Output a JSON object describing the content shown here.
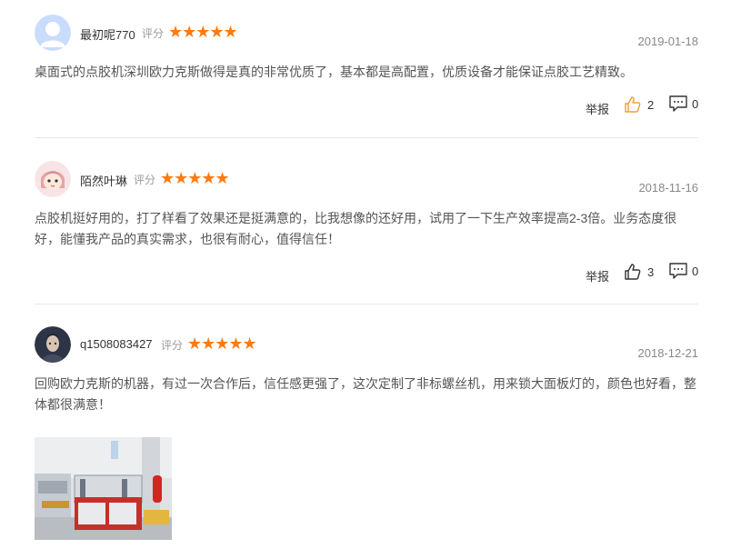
{
  "rating_label": "评分",
  "report_label": "举报",
  "reviews": [
    {
      "username": "最初呢770",
      "stars": 5,
      "date": "2019-01-18",
      "content": "桌面式的点胶机深圳欧力克斯做得是真的非常优质了，基本都是高配置，优质设备才能保证点胶工艺精致。",
      "likes": "2",
      "comments": "0",
      "avatar": "default-user-icon"
    },
    {
      "username": "陌然叶琳",
      "stars": 5,
      "date": "2018-11-16",
      "content": "点胶机挺好用的，打了样看了效果还是挺满意的，比我想像的还好用，试用了一下生产效率提高2-3倍。业务态度很好，能懂我产品的真实需求，也很有耐心，值得信任！",
      "likes": "3",
      "comments": "0",
      "avatar": "cartoon-girl-icon"
    },
    {
      "username": "q1508083427",
      "stars": 5,
      "date": "2018-12-21",
      "content": "回购欧力克斯的机器，有过一次合作后，信任感更强了，这次定制了非标螺丝机，用来锁大面板灯的，颜色也好看，整体都很满意！",
      "avatar": "character-portrait-icon",
      "photo": "machine-photo"
    }
  ],
  "colors": {
    "star": "#ff7a10",
    "like_active": "#f29d38",
    "text": "#555555",
    "date": "#888888"
  }
}
